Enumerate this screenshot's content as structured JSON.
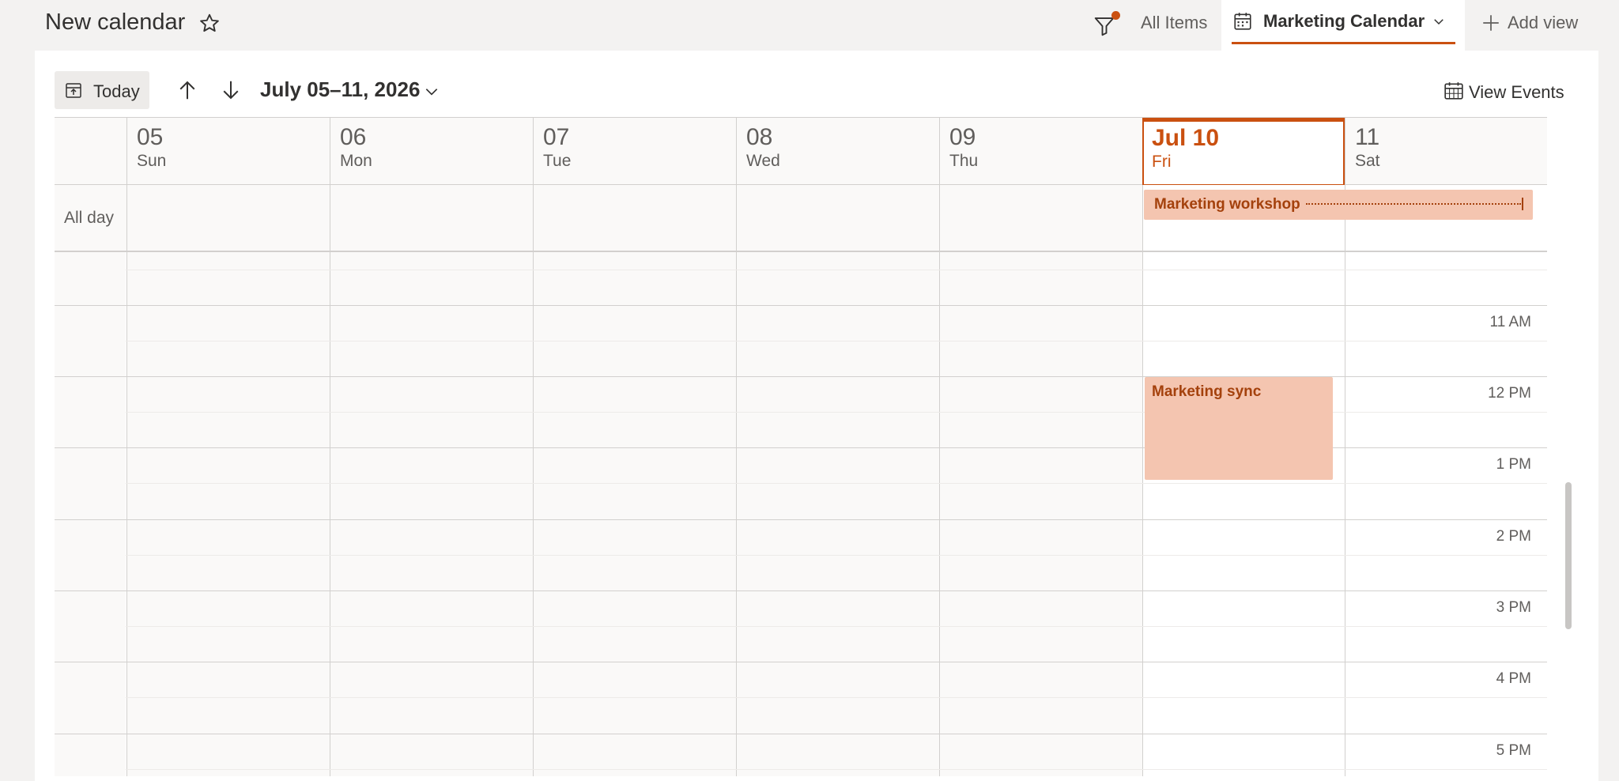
{
  "header": {
    "title": "New calendar",
    "all_items": "All Items",
    "active_view": "Marketing Calendar",
    "add_view": "Add view"
  },
  "toolbar": {
    "today": "Today",
    "date_range": "July 05–11, 2026",
    "view_events": "View Events"
  },
  "calendar": {
    "all_day_label": "All day",
    "days": [
      {
        "num": "05",
        "name": "Sun"
      },
      {
        "num": "06",
        "name": "Mon"
      },
      {
        "num": "07",
        "name": "Tue"
      },
      {
        "num": "08",
        "name": "Wed"
      },
      {
        "num": "09",
        "name": "Thu"
      },
      {
        "num": "Jul 10",
        "name": "Fri",
        "today": true
      },
      {
        "num": "11",
        "name": "Sat"
      }
    ],
    "hours": [
      "11 AM",
      "12 PM",
      "1 PM",
      "2 PM",
      "3 PM",
      "4 PM",
      "5 PM"
    ],
    "events": {
      "all_day": "Marketing workshop",
      "timed": "Marketing sync"
    }
  },
  "colors": {
    "accent": "#ca5010",
    "event_fill": "#f4c5b0",
    "event_text": "#a4410c"
  }
}
